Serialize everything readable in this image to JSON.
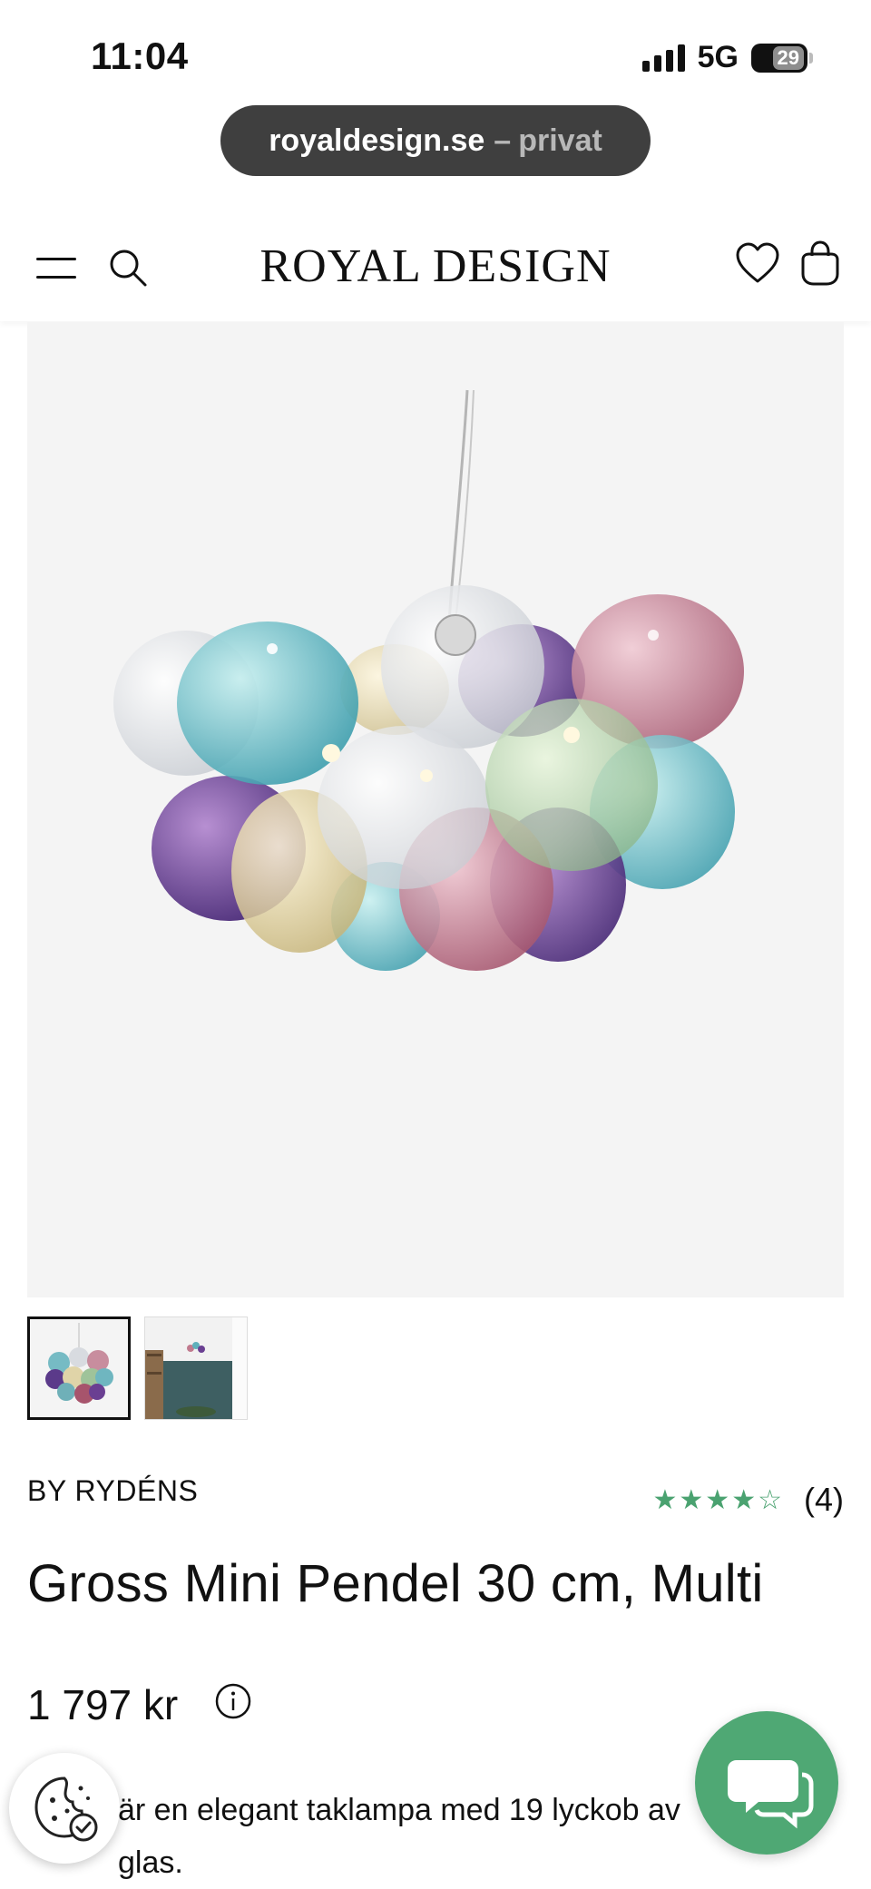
{
  "status_bar": {
    "time": "11:04",
    "network": "5G",
    "battery": "29"
  },
  "browser": {
    "domain": "royaldesign.se",
    "separator": "–",
    "mode": "privat"
  },
  "header": {
    "brand": "ROYAL DESIGN",
    "icons": [
      "menu-icon",
      "search-icon",
      "heart-icon",
      "shopping-bag-icon"
    ]
  },
  "product": {
    "brand_line": "BY RYDÉNS",
    "rating_stars": "★★★★☆",
    "rating_value": 4,
    "rating_count": "(4)",
    "title": "Gross Mini Pendel 30 cm, Multi",
    "price": "1 797 kr",
    "description": "är en elegant taklampa med 19 lyckob av glas."
  },
  "thumbnails": [
    "thumbnail-1",
    "thumbnail-2"
  ],
  "colors": {
    "rating_green": "#4aa270",
    "chat_green": "#4fa874",
    "url_pill": "#3f3f3f",
    "image_bg": "#f4f4f4"
  }
}
